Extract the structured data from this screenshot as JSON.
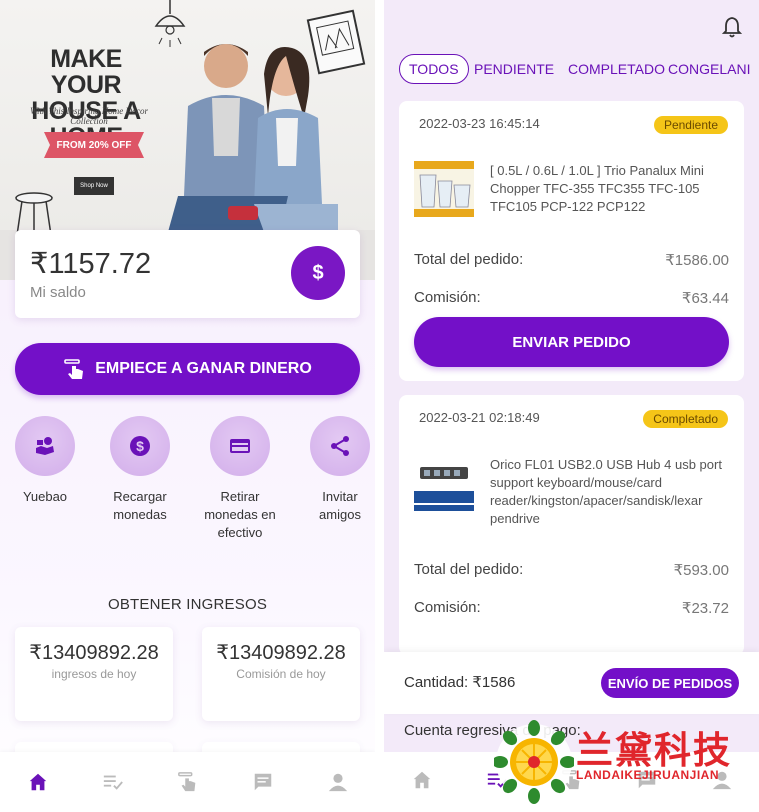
{
  "colors": {
    "primary": "#7310c8",
    "badge": "#f5c518",
    "watermark": "#e0262c"
  },
  "banner": {
    "title": "MAKE YOUR HOUSE A HOME",
    "subtitle": "With This Inspiring Home Decor Collection",
    "promo": "FROM 20% OFF",
    "shop_button": "Shop Now"
  },
  "balance": {
    "amount": "₹1157.72",
    "label": "Mi saldo",
    "icon": "$"
  },
  "earn_button": "EMPIECE A GANAR DINERO",
  "quick_actions": [
    {
      "label": "Yuebao",
      "icon": "hand-coins-icon"
    },
    {
      "label": "Recargar monedas",
      "icon": "dollar-coin-icon"
    },
    {
      "label": "Retirar monedas en efectivo",
      "icon": "credit-card-icon"
    },
    {
      "label": "Invitar amigos",
      "icon": "share-icon"
    }
  ],
  "income": {
    "title": "OBTENER INGRESOS",
    "cards": [
      {
        "value": "₹13409892.28",
        "label": "ingresos de hoy"
      },
      {
        "value": "₹13409892.28",
        "label": "Comisión de hoy"
      }
    ]
  },
  "tabs": [
    "home-icon",
    "list-check-icon",
    "tap-hand-icon",
    "message-icon",
    "user-icon"
  ],
  "orders_page": {
    "filters": [
      "TODOS",
      "PENDIENTE",
      "COMPLETADO",
      "CONGELANI"
    ],
    "orders": [
      {
        "date": "2022-03-23 16:45:14",
        "status": "Pendiente",
        "product": "[ 0.5L / 0.6L / 1.0L ] Trio Panalux Mini Chopper TFC-355 TFC355 TFC-105 TFC105 PCP-122 PCP122",
        "total_label": "Total del pedido:",
        "total": "₹1586.00",
        "commission_label": "Comisión:",
        "commission": "₹63.44",
        "action": "ENVIAR PEDIDO"
      },
      {
        "date": "2022-03-21 02:18:49",
        "status": "Completado",
        "product": "Orico FL01 USB2.0 USB Hub 4 usb port support keyboard/mouse/card reader/kingston/apacer/sandisk/lexar pendrive",
        "total_label": "Total del pedido:",
        "total": "₹593.00",
        "commission_label": "Comisión:",
        "commission": "₹23.72"
      }
    ],
    "quantity": "Cantidad:  ₹1586",
    "send_orders": "ENVÍO DE PEDIDOS",
    "countdown": "Cuenta regresiva de pago:"
  },
  "watermark": {
    "cn": "兰黛科技",
    "en": "LANDAIKEJIRUANJIAN"
  }
}
